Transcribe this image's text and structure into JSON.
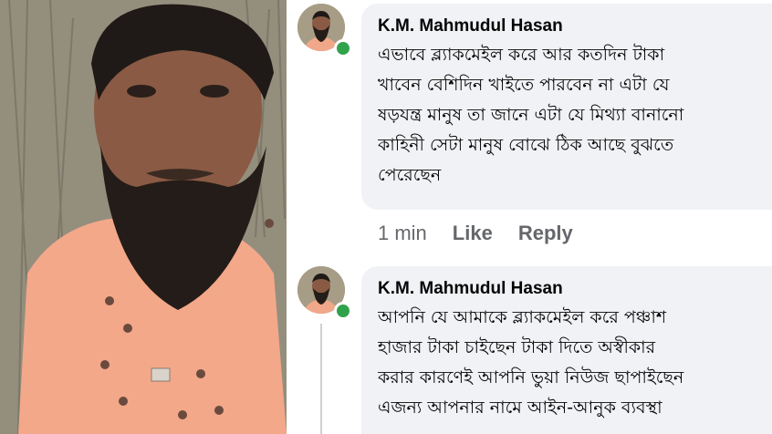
{
  "comments": [
    {
      "author": "K.M. Mahmudul Hasan",
      "lines": [
        "এভাবে ব্ল্যাকমেইল করে আর কতদিন টাকা",
        "খাবেন বেশিদিন খাইতে পারবেন না  এটা যে",
        "ষড়যন্ত্র মানুষ তা জানে এটা যে মিথ্যা বানানো",
        "কাহিনী সেটা মানুষ বোঝে ঠিক আছে বুঝতে",
        "পেরেছেন"
      ],
      "time": "1 min",
      "like": "Like",
      "reply": "Reply",
      "online": true
    },
    {
      "author": "K.M. Mahmudul Hasan",
      "lines": [
        "আপনি যে আমাকে ব্ল্যাকমেইল করে পঞ্চাশ",
        "হাজার টাকা চাইছেন টাকা দিতে অস্বীকার",
        "করার কারণেই আপনি ভুয়া নিউজ ছাপাইছেন",
        "এজন্য আপনার নামে আইন-আনুক ব্যবস্থা"
      ],
      "online": true
    }
  ],
  "colors": {
    "bubble": "#f0f2f5",
    "text": "#050505",
    "meta": "#65676b",
    "online": "#31a24c"
  }
}
